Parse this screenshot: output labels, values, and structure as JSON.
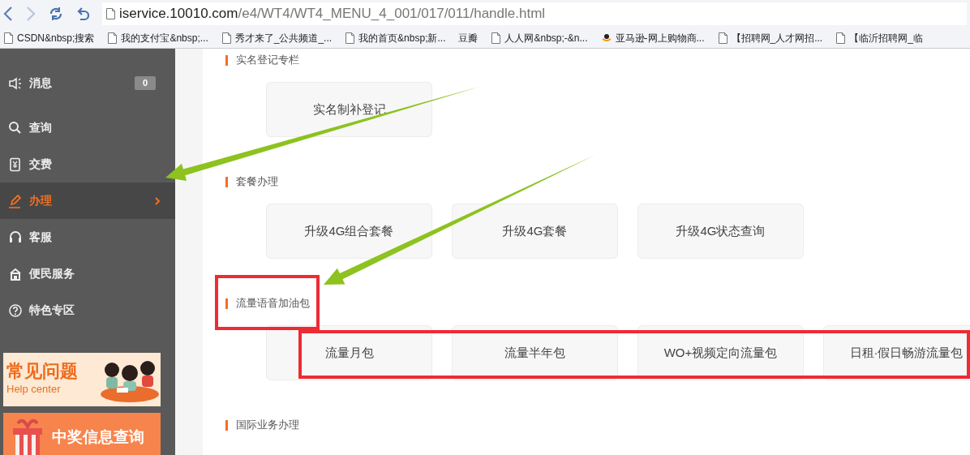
{
  "browser": {
    "address": {
      "host": "iservice.10010.com",
      "path": "/e4/WT4/WT4_MENU_4_001/017/011/handle.html"
    },
    "bookmarks": [
      {
        "label": "CSDN&nbsp;搜索",
        "kind": "page"
      },
      {
        "label": "我的支付宝&nbsp;...",
        "kind": "page"
      },
      {
        "label": "秀才来了_公共频道_...",
        "kind": "page"
      },
      {
        "label": "我的首页&nbsp;新...",
        "kind": "page"
      },
      {
        "label": "豆瓣",
        "kind": "none"
      },
      {
        "label": "人人网&nbsp;-&n...",
        "kind": "page"
      },
      {
        "label": "亚马逊-网上购物商...",
        "kind": "shop"
      },
      {
        "label": "【招聘网_人才网招...",
        "kind": "page"
      },
      {
        "label": "【临沂招聘网_临",
        "kind": "page"
      }
    ]
  },
  "sidebar": {
    "items": [
      {
        "label": "消息",
        "badge": "0",
        "selected": false
      },
      {
        "label": "查询",
        "selected": false
      },
      {
        "label": "交费",
        "selected": false
      },
      {
        "label": "办理",
        "selected": true,
        "arrow": true
      },
      {
        "label": "客服",
        "selected": false
      },
      {
        "label": "便民服务",
        "selected": false
      },
      {
        "label": "特色专区",
        "selected": false
      }
    ],
    "banners": [
      {
        "kind": "help",
        "title": "常见问题",
        "subtitle": "Help center"
      },
      {
        "kind": "prize",
        "title": "中奖信息查询"
      }
    ]
  },
  "sections": [
    {
      "title": "实名登记专栏",
      "highlighted": false,
      "tiles": [
        "实名制补登记"
      ]
    },
    {
      "title": "套餐办理",
      "highlighted": false,
      "tiles": [
        "升级4G组合套餐",
        "升级4G套餐",
        "升级4G状态查询"
      ]
    },
    {
      "title": "流量语音加油包",
      "highlighted": true,
      "arrow": true,
      "tiles_highlighted": true,
      "tiles": [
        "流量月包",
        "流量半年包",
        "WO+视频定向流量包",
        "日租·假日畅游流量包"
      ]
    },
    {
      "title": "国际业务办理",
      "highlighted": false
    }
  ]
}
